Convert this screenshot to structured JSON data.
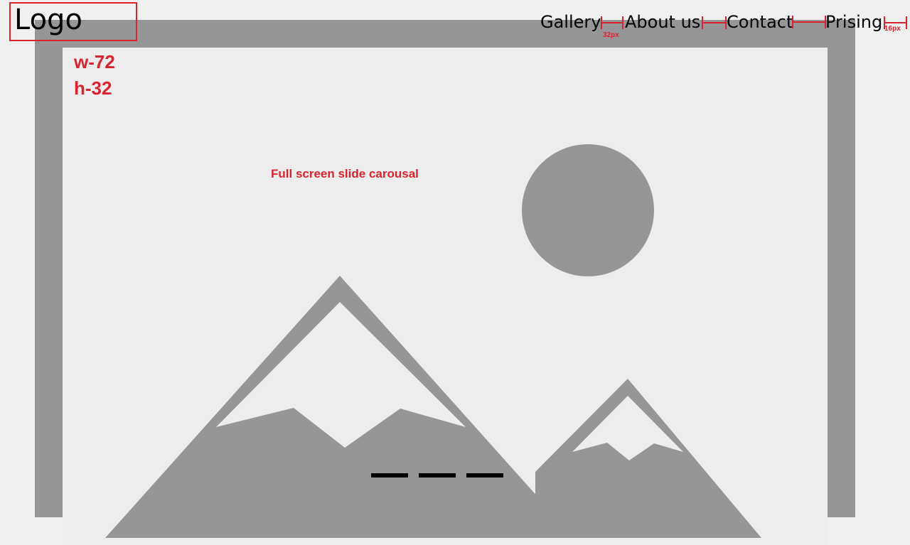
{
  "header": {
    "logo": "Logo",
    "nav": [
      "Gallery",
      "About us",
      "Contact",
      "Prising"
    ]
  },
  "annotations": {
    "logo_width": "w-72",
    "logo_height": "h-32",
    "carousel_note": "Full screen slide carousal",
    "nav_gap": "32px",
    "right_padding": "16px"
  },
  "carousel": {
    "indicator_count": 3
  },
  "colors": {
    "annotation": "#d9232d",
    "placeholder_gray": "#969698",
    "placeholder_bg": "#ededed"
  },
  "icons": [
    "image-placeholder-icon"
  ]
}
